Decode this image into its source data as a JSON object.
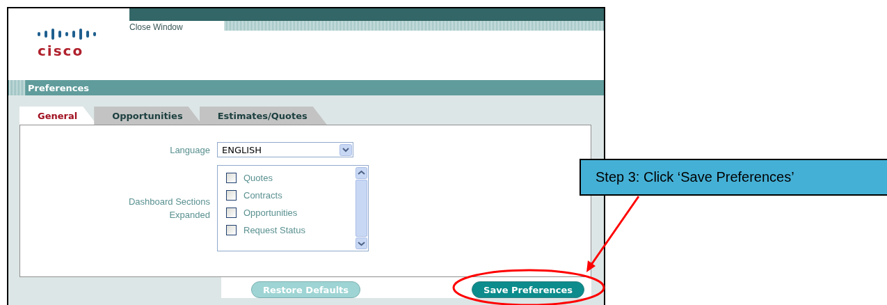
{
  "header": {
    "logo_text": "cisco",
    "close_link": "Close Window"
  },
  "section_title": "Preferences",
  "tabs": [
    {
      "label": "General",
      "selected": true
    },
    {
      "label": "Opportunities",
      "selected": false
    },
    {
      "label": "Estimates/Quotes",
      "selected": false
    }
  ],
  "form": {
    "language_label": "Language",
    "language_value": "ENGLISH",
    "sections_label": "Dashboard Sections Expanded",
    "sections": [
      {
        "label": "Quotes",
        "checked": false
      },
      {
        "label": "Contracts",
        "checked": false
      },
      {
        "label": "Opportunities",
        "checked": false
      },
      {
        "label": "Request Status",
        "checked": false
      }
    ]
  },
  "buttons": [
    {
      "label": "Restore Defaults",
      "disabled": true
    },
    {
      "label": "Save Preferences",
      "disabled": false
    }
  ],
  "annotation": {
    "text": "Step 3: Click ‘Save Preferences’"
  }
}
